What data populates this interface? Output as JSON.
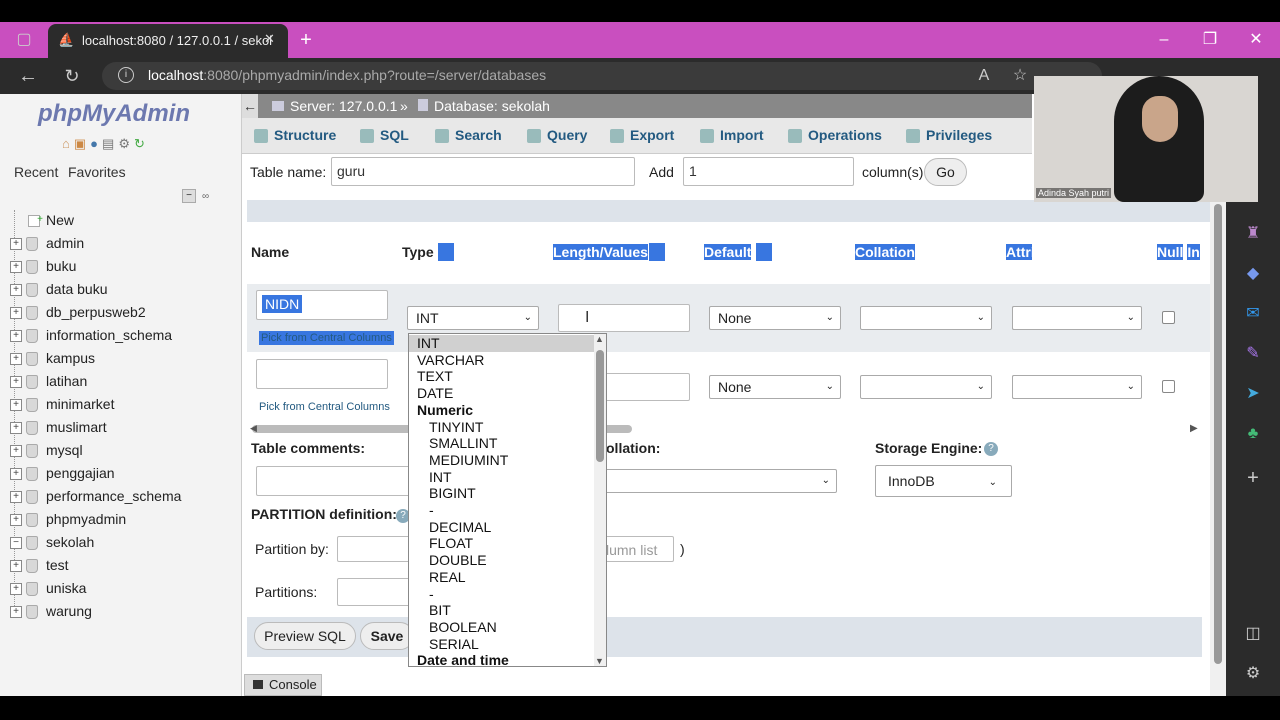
{
  "browser": {
    "tab_title": "localhost:8080 / 127.0.0.1 / sekol",
    "url_host": "localhost",
    "url_rest": ":8080/phpmyadmin/index.php?route=/server/databases"
  },
  "pma": {
    "logo": "phpMyAdmin",
    "recent": "Recent",
    "favorites": "Favorites",
    "new_item": "New",
    "databases": [
      "admin",
      "buku",
      "data buku",
      "db_perpusweb2",
      "information_schema",
      "kampus",
      "latihan",
      "minimarket",
      "muslimart",
      "mysql",
      "penggajian",
      "performance_schema",
      "phpmyadmin",
      "sekolah",
      "test",
      "uniska",
      "warung"
    ],
    "breadcrumb_server": "Server: 127.0.0.1",
    "breadcrumb_sep": "»",
    "breadcrumb_db": "Database: sekolah",
    "tabs": [
      "Structure",
      "SQL",
      "Search",
      "Query",
      "Export",
      "Import",
      "Operations",
      "Privileges"
    ]
  },
  "form": {
    "table_name_label": "Table name:",
    "table_name_value": "guru",
    "add_label": "Add",
    "add_value": "1",
    "columns_label": "column(s)",
    "go": "Go",
    "col_name": "Name",
    "col_type": "Type",
    "col_length": "Length/Values",
    "col_default": "Default",
    "col_collation": "Collation",
    "col_attributes": "Attributes",
    "col_null": "Null",
    "col_index": "In",
    "row1_name": "NIDN",
    "row1_type": "INT",
    "default_none": "None",
    "pick_central": "Pick from Central Columns",
    "table_comments": "Table comments:",
    "collation_label": "ollation:",
    "storage_engine_label": "Storage Engine:",
    "storage_engine_value": "InnoDB",
    "partition_def": "PARTITION definition:",
    "partition_by": "Partition by:",
    "column_list_ph": "lumn list",
    "paren": ")",
    "partitions": "Partitions:",
    "preview_sql": "Preview SQL",
    "save": "Save",
    "console": "Console"
  },
  "dropdown": {
    "options": [
      {
        "label": "INT",
        "kind": "sel"
      },
      {
        "label": "VARCHAR",
        "kind": "opt"
      },
      {
        "label": "TEXT",
        "kind": "opt"
      },
      {
        "label": "DATE",
        "kind": "opt"
      },
      {
        "label": "Numeric",
        "kind": "grp"
      },
      {
        "label": "TINYINT",
        "kind": "sub"
      },
      {
        "label": "SMALLINT",
        "kind": "sub"
      },
      {
        "label": "MEDIUMINT",
        "kind": "sub"
      },
      {
        "label": "INT",
        "kind": "sub"
      },
      {
        "label": "BIGINT",
        "kind": "sub"
      },
      {
        "label": "-",
        "kind": "sub"
      },
      {
        "label": "DECIMAL",
        "kind": "sub"
      },
      {
        "label": "FLOAT",
        "kind": "sub"
      },
      {
        "label": "DOUBLE",
        "kind": "sub"
      },
      {
        "label": "REAL",
        "kind": "sub"
      },
      {
        "label": "-",
        "kind": "sub"
      },
      {
        "label": "BIT",
        "kind": "sub"
      },
      {
        "label": "BOOLEAN",
        "kind": "sub"
      },
      {
        "label": "SERIAL",
        "kind": "sub"
      },
      {
        "label": "Date and time",
        "kind": "grp"
      }
    ]
  },
  "webcam": {
    "name": "Adinda Syah putri"
  },
  "colors": {
    "titlebar": "#c94fbf",
    "highlight": "#3876e0",
    "link": "#235a81"
  }
}
